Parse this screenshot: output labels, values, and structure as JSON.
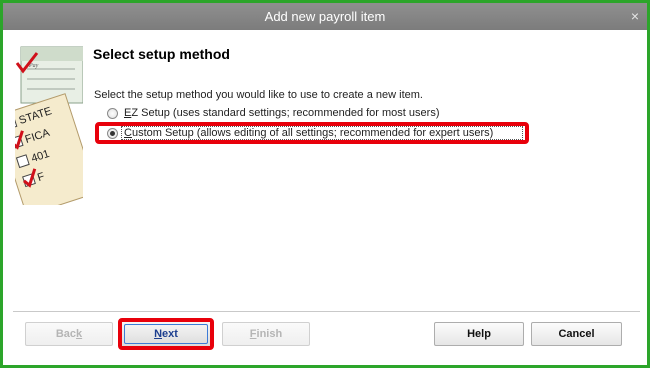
{
  "window": {
    "title": "Add new payroll item",
    "close_glyph": "×"
  },
  "illustration": {
    "icon": "payroll-forms-illustration",
    "check_text": "Pay",
    "items": [
      "STATE",
      "FICA",
      "401",
      "F"
    ]
  },
  "page": {
    "heading": "Select setup method",
    "instruction": "Select the setup method you would like to use to create a new item."
  },
  "options": {
    "ez": {
      "accelerator": "E",
      "label_rest": "Z Setup (uses standard settings; recommended for most users)",
      "selected": false
    },
    "custom": {
      "accelerator": "C",
      "label_rest": "ustom Setup (allows editing of all settings; recommended for expert users)",
      "selected": true
    }
  },
  "buttons": {
    "back": {
      "pre": "Bac",
      "accel": "k",
      "post": "",
      "enabled": false
    },
    "next": {
      "pre": "",
      "accel": "N",
      "post": "ext",
      "enabled": true
    },
    "finish": {
      "pre": "",
      "accel": "F",
      "post": "inish",
      "enabled": false
    },
    "help": {
      "label": "Help"
    },
    "cancel": {
      "label": "Cancel"
    }
  },
  "colors": {
    "frame_border": "#2ca52a",
    "highlight": "#e8000b",
    "titlebar": "#8a8a8a"
  }
}
